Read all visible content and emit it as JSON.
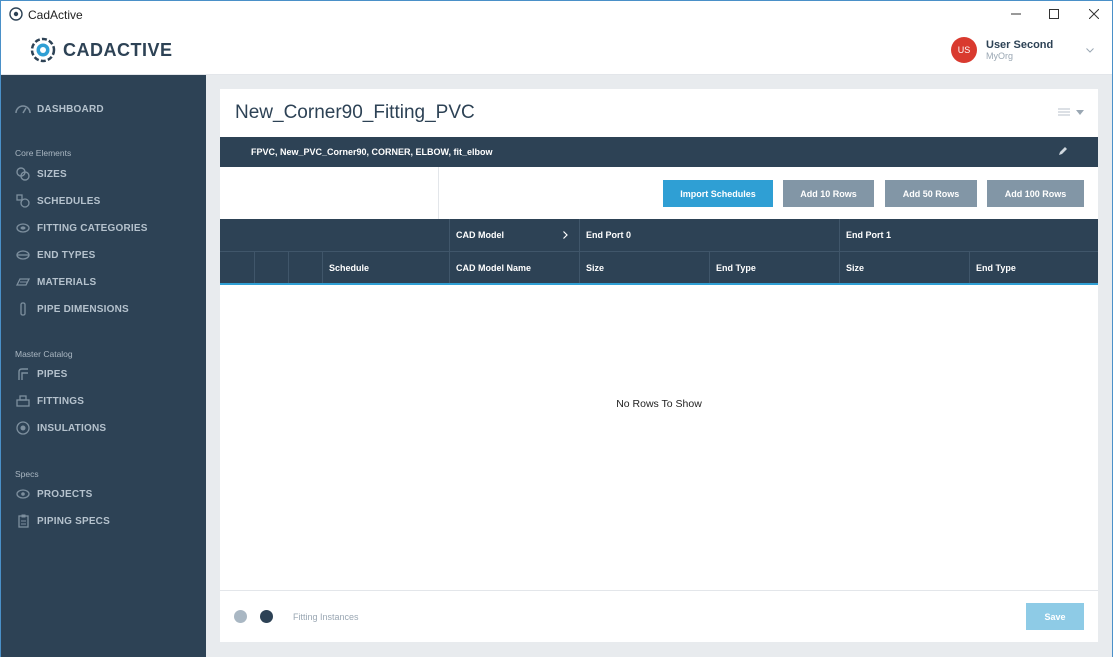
{
  "window": {
    "title": "CadActive"
  },
  "header": {
    "logo_text": "CADACTIVE",
    "user": {
      "initials": "US",
      "name": "User Second",
      "org": "MyOrg"
    }
  },
  "sidebar": {
    "dashboard": "DASHBOARD",
    "sections": {
      "core": "Core Elements",
      "master": "Master Catalog",
      "specs": "Specs"
    },
    "core_items": [
      "SIZES",
      "SCHEDULES",
      "FITTING CATEGORIES",
      "END TYPES",
      "MATERIALS",
      "PIPE DIMENSIONS"
    ],
    "master_items": [
      "PIPES",
      "FITTINGS",
      "INSULATIONS"
    ],
    "spec_items": [
      "PROJECTS",
      "PIPING SPECS"
    ]
  },
  "page": {
    "title": "New_Corner90_Fitting_PVC",
    "tags": "FPVC, New_PVC_Corner90, CORNER, ELBOW, fit_elbow"
  },
  "toolbar": {
    "import_label": "Import Schedules",
    "add10_label": "Add 10 Rows",
    "add50_label": "Add 50 Rows",
    "add100_label": "Add 100 Rows"
  },
  "grid": {
    "group_headers": [
      "CAD Model",
      "End Port 0",
      "End Port 1"
    ],
    "columns": [
      "Schedule",
      "CAD Model Name",
      "Size",
      "End Type",
      "Size",
      "End Type"
    ],
    "empty_message": "No Rows To Show"
  },
  "footer": {
    "label": "Fitting Instances",
    "save_label": "Save"
  },
  "colors": {
    "sidebar_bg": "#2d4255",
    "accent": "#2f9fd4",
    "gray_button": "#8296a6",
    "avatar": "#d93a2f"
  }
}
